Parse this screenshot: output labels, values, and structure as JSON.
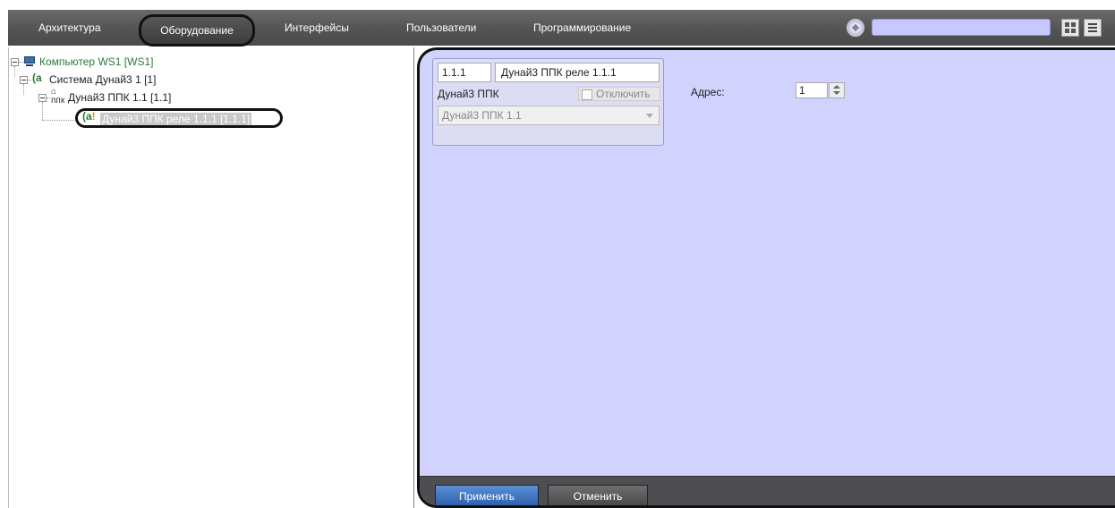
{
  "nav": {
    "tabs": [
      {
        "label": "Архитектура"
      },
      {
        "label": "Оборудование"
      },
      {
        "label": "Интерфейсы"
      },
      {
        "label": "Пользователи"
      },
      {
        "label": "Программирование"
      }
    ],
    "active_tab": "Оборудование",
    "search": {
      "value": "",
      "placeholder": ""
    }
  },
  "tree": {
    "items": [
      {
        "label": "Компьютер WS1 [WS1]",
        "icon": "computer-icon",
        "expanded": true
      },
      {
        "label": "Система Дунай3 1 [1]",
        "icon": "system-icon",
        "expanded": true
      },
      {
        "label": "Дунай3 ППК 1.1 [1.1]",
        "icon": "ppk-icon",
        "expanded": true
      },
      {
        "label": "Дунай3 ППК реле 1.1.1 [1.1.1]",
        "icon": "relay-icon",
        "selected": true
      }
    ]
  },
  "card": {
    "id": "1.1.1",
    "name": "Дунай3 ППК реле 1.1.1",
    "type_label": "Дунай3 ППК",
    "disable_label": "Отключить",
    "parent_select": "Дунай3 ППК 1.1"
  },
  "settings": {
    "address_label": "Адрес:",
    "address_value": "1"
  },
  "footer": {
    "apply_label": "Применить",
    "cancel_label": "Отменить"
  },
  "colors": {
    "panel_bg": "#d2d2ff",
    "nav_bg": "#555555",
    "apply_bg": "#2e62ad",
    "tree_green": "#2a7a3a"
  }
}
